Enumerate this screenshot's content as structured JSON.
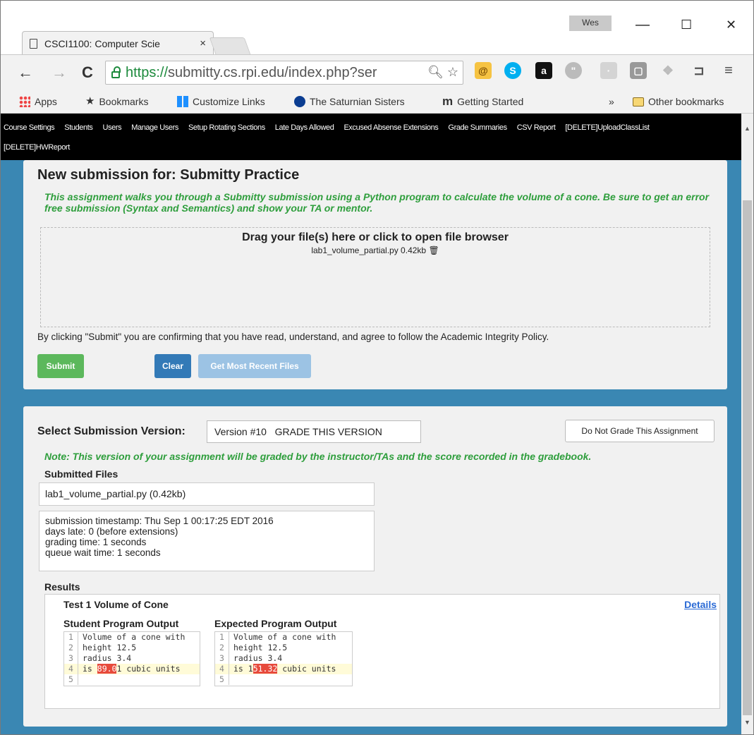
{
  "browser": {
    "tab_title": "CSCI1100: Computer Scie",
    "tab_close": "×",
    "profile_name": "Wes",
    "minimize": "—",
    "maximize": "☐",
    "close": "✕",
    "url_scheme": "https://",
    "url_rest": "submitty.cs.rpi.edu/index.php?ser",
    "bookmarks": [
      {
        "label": "Apps"
      },
      {
        "label": "Bookmarks"
      },
      {
        "label": "Customize Links"
      },
      {
        "label": "The Saturnian Sisters"
      },
      {
        "label": "Getting Started"
      }
    ],
    "bookmarks_overflow": "»",
    "other_bookmarks": "Other bookmarks"
  },
  "nav": {
    "items": [
      "Course Settings",
      "Students",
      "Users",
      "Manage Users",
      "Setup Rotating Sections",
      "Late Days Allowed",
      "Excused Absense Extensions",
      "Grade Summaries",
      "CSV Report",
      "[DELETE]UploadClassList",
      "[DELETE]HWReport"
    ]
  },
  "submission": {
    "heading": "New submission for: Submitty Practice",
    "description": "This assignment walks you through a Submitty submission using a Python program to calculate the volume of a cone. Be sure to get an error free submission (Syntax and Semantics) and show your TA or mentor.",
    "drop_label": "Drag your file(s) here or click to open file browser",
    "file_entry": "lab1_volume_partial.py 0.42kb",
    "agreement": "By clicking \"Submit\" you are confirming that you have read, understand, and agree to follow the Academic Integrity Policy.",
    "submit_label": "Submit",
    "clear_label": "Clear",
    "recent_label": "Get Most Recent Files"
  },
  "version": {
    "select_label": "Select Submission Version:",
    "selected_version": "Version #10   GRADE THIS VERSION",
    "do_not_grade_label": "Do Not Grade This Assignment",
    "note": "Note: This version of your assignment will be graded by the instructor/TAs and the score recorded in the gradebook.",
    "submitted_files_label": "Submitted Files",
    "submitted_file": "lab1_volume_partial.py (0.42kb)",
    "info": [
      "submission timestamp: Thu Sep 1 00:17:25 EDT 2016",
      "days late: 0 (before extensions)",
      "grading time: 1 seconds",
      "queue wait time: 1 seconds"
    ],
    "results_label": "Results",
    "test_title": "Test 1 Volume of Cone",
    "details_label": "Details",
    "student_output_label": "Student Program Output",
    "expected_output_label": "Expected Program Output",
    "student_lines": [
      {
        "n": "1",
        "pre": "Volume of a cone with",
        "mark": "",
        "post": ""
      },
      {
        "n": "2",
        "pre": "height 12.5",
        "mark": "",
        "post": ""
      },
      {
        "n": "3",
        "pre": "radius 3.4",
        "mark": "",
        "post": ""
      },
      {
        "n": "4",
        "pre": "is ",
        "mark": "89.0",
        "post": "1 cubic units"
      },
      {
        "n": "5",
        "pre": "",
        "mark": "",
        "post": ""
      }
    ],
    "expected_lines": [
      {
        "n": "1",
        "pre": "Volume of a cone with",
        "mark": "",
        "post": ""
      },
      {
        "n": "2",
        "pre": "height 12.5",
        "mark": "",
        "post": ""
      },
      {
        "n": "3",
        "pre": "radius 3.4",
        "mark": "",
        "post": ""
      },
      {
        "n": "4",
        "pre": "is 1",
        "mark": "51.32",
        "post": " cubic units"
      },
      {
        "n": "5",
        "pre": "",
        "mark": "",
        "post": ""
      }
    ]
  }
}
